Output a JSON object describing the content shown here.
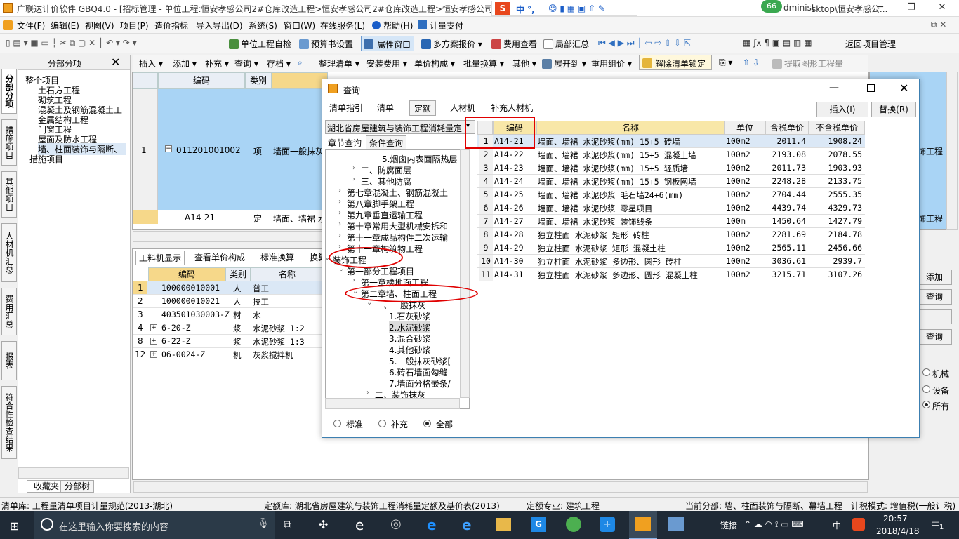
{
  "window": {
    "title": "广联达计价软件 GBQ4.0 - [招标管理 - 单位工程:恒安孝感公司2#仓库改造工程>恒安孝感公司2#仓库改造工程>恒安孝感公司2#",
    "title_tail": "dministrator.PC-20141127NRH",
    "title_tail2": "sktop\\恒安孝感公...",
    "badge": "66",
    "min": "─",
    "max": "❐",
    "close": "✕"
  },
  "menubar": [
    "文件(F)",
    "编辑(E)",
    "视图(V)",
    "项目(P)",
    "造价指标",
    "导入导出(D)",
    "系统(S)",
    "窗口(W)",
    "在线服务(L)",
    "帮助(H)",
    "计量支付"
  ],
  "toolbar1": {
    "self_check": "单位工程自检",
    "budget_settings": "预算书设置",
    "property_window": "属性窗口",
    "multi_plan": "多方案报价",
    "fee_view": "费用查看",
    "partial_total": "局部汇总",
    "return_project": "返回项目管理"
  },
  "toolbar2": [
    "插入",
    "添加",
    "补充",
    "查询",
    "存档",
    "整理清单",
    "安装费用",
    "单价构成",
    "批量换算",
    "其他",
    "展开到",
    "重用组价",
    "解除清单锁定",
    "提取图形工程量"
  ],
  "vtabs": [
    "分部分项",
    "措施项目",
    "其他项目",
    "人材机汇总",
    "费用汇总",
    "报表",
    "符合性检查结果"
  ],
  "leftpanel": {
    "title": "分部分项",
    "items": [
      "整个项目",
      "土石方工程",
      "砌筑工程",
      "混凝土及钢筋混凝土工",
      "金属结构工程",
      "门窗工程",
      "屋面及防水工程",
      "墙、柱面装饰与隔断、",
      "措施项目"
    ],
    "bottom_tabs": [
      "收藏夹",
      "分部树"
    ]
  },
  "grid": {
    "headers": [
      "编码",
      "类别"
    ],
    "rows": [
      {
        "num": "1",
        "code": "011201001002",
        "type": "项",
        "name": "墙面一般抹灰",
        "tail": "饰工程"
      },
      {
        "num": "",
        "code": "A14-21",
        "type": "定",
        "name": "墙面、墙裙 水",
        "tail": "饰工程"
      }
    ]
  },
  "lower": {
    "tabs": [
      "工料机显示",
      "查看单价构成",
      "标准换算",
      "换算"
    ],
    "headers": [
      "编码",
      "类别",
      "名称"
    ],
    "rows": [
      {
        "num": "1",
        "code": "100000010001",
        "type": "人",
        "name": "普工"
      },
      {
        "num": "2",
        "code": "100000010021",
        "type": "人",
        "name": "技工"
      },
      {
        "num": "3",
        "code": "403501030003-Z",
        "type": "材",
        "name": "水"
      },
      {
        "num": "4",
        "code": "6-20-Z",
        "type": "浆",
        "name": "水泥砂浆 1:2"
      },
      {
        "num": "8",
        "code": "6-22-Z",
        "type": "浆",
        "name": "水泥砂浆 1:3"
      },
      {
        "num": "12",
        "code": "06-0024-Z",
        "type": "机",
        "name": "灰浆搅拌机"
      }
    ]
  },
  "right_side": {
    "buttons": [
      "添加",
      "查询",
      "查询"
    ],
    "radios": [
      {
        "label": "机械",
        "on": false
      },
      {
        "label": "设备",
        "on": false
      },
      {
        "label": "所有",
        "on": true
      }
    ]
  },
  "dialog": {
    "title": "查询",
    "tabs": [
      "清单指引",
      "清单",
      "定额",
      "人材机",
      "补充人材机"
    ],
    "insert_btn": "插入(I)",
    "replace_btn": "替换(R)",
    "quota_library": "湖北省房屋建筑与装饰工程消耗量定",
    "subtabs": [
      "章节查询",
      "条件查询"
    ],
    "tree": [
      {
        "text": "5.烟囱内表面隔热层",
        "indent": 80
      },
      {
        "text": "二、防腐面层",
        "indent": 50
      },
      {
        "text": "三、其他防腐",
        "indent": 50
      },
      {
        "text": "第七章混凝土、钢筋混凝土",
        "indent": 30
      },
      {
        "text": "第八章脚手架工程",
        "indent": 30
      },
      {
        "text": "第九章垂直运输工程",
        "indent": 30
      },
      {
        "text": "第十章常用大型机械安拆和",
        "indent": 30
      },
      {
        "text": "第十一章成品构件二次运输",
        "indent": 30
      },
      {
        "text": "第十一章构筑物工程",
        "indent": 30
      },
      {
        "text": "装饰工程",
        "indent": 10
      },
      {
        "text": "第一部分工程项目",
        "indent": 30
      },
      {
        "text": "第一章楼地面工程",
        "indent": 50
      },
      {
        "text": "第二章墙、柱面工程",
        "indent": 50
      },
      {
        "text": "一、一般抹灰",
        "indent": 70
      },
      {
        "text": "1.石灰砂浆",
        "indent": 90
      },
      {
        "text": "2.水泥砂浆",
        "indent": 90
      },
      {
        "text": "3.混合砂浆",
        "indent": 90
      },
      {
        "text": "4.其他砂浆",
        "indent": 90
      },
      {
        "text": "5.一般抹灰砂浆[",
        "indent": 90
      },
      {
        "text": "6.砖石墙面勾缝",
        "indent": 90
      },
      {
        "text": "7.墙面分格嵌条/",
        "indent": 90
      },
      {
        "text": "二、装饰抹灰",
        "indent": 70
      }
    ],
    "radios": [
      {
        "label": "标准",
        "on": false
      },
      {
        "label": "补充",
        "on": false
      },
      {
        "label": "全部",
        "on": true
      }
    ],
    "table_headers": [
      "编码",
      "名称",
      "单位",
      "含税单价",
      "不含税单价"
    ],
    "table_rows": [
      {
        "n": "1",
        "code": "A14-21",
        "name": "墙面、墙裙 水泥砂浆(mm) 15+5 砖墙",
        "unit": "100m2",
        "tax": "2011.4",
        "notax": "1908.24"
      },
      {
        "n": "2",
        "code": "A14-22",
        "name": "墙面、墙裙 水泥砂浆(mm) 15+5 混凝土墙",
        "unit": "100m2",
        "tax": "2193.08",
        "notax": "2078.55"
      },
      {
        "n": "3",
        "code": "A14-23",
        "name": "墙面、墙裙 水泥砂浆(mm) 15+5 轻质墙",
        "unit": "100m2",
        "tax": "2011.73",
        "notax": "1903.93"
      },
      {
        "n": "4",
        "code": "A14-24",
        "name": "墙面、墙裙 水泥砂浆(mm) 15+5 钢板网墙",
        "unit": "100m2",
        "tax": "2248.28",
        "notax": "2133.75"
      },
      {
        "n": "5",
        "code": "A14-25",
        "name": "墙面、墙裙 水泥砂浆 毛石墙24+6(mm)",
        "unit": "100m2",
        "tax": "2704.44",
        "notax": "2555.35"
      },
      {
        "n": "6",
        "code": "A14-26",
        "name": "墙面、墙裙 水泥砂浆 零星项目",
        "unit": "100m2",
        "tax": "4439.74",
        "notax": "4329.73"
      },
      {
        "n": "7",
        "code": "A14-27",
        "name": "墙面、墙裙 水泥砂浆 装饰线条",
        "unit": "100m",
        "tax": "1450.64",
        "notax": "1427.79"
      },
      {
        "n": "8",
        "code": "A14-28",
        "name": "独立柱面 水泥砂浆 矩形 砖柱",
        "unit": "100m2",
        "tax": "2281.69",
        "notax": "2184.78"
      },
      {
        "n": "9",
        "code": "A14-29",
        "name": "独立柱面 水泥砂浆 矩形 混凝土柱",
        "unit": "100m2",
        "tax": "2565.11",
        "notax": "2456.66"
      },
      {
        "n": "10",
        "code": "A14-30",
        "name": "独立柱面 水泥砂浆 多边形、圆形 砖柱",
        "unit": "100m2",
        "tax": "3036.61",
        "notax": "2939.7"
      },
      {
        "n": "11",
        "code": "A14-31",
        "name": "独立柱面 水泥砂浆 多边形、圆形 混凝土柱",
        "unit": "100m2",
        "tax": "3215.71",
        "notax": "3107.26"
      }
    ]
  },
  "statusbar": [
    "清单库: 工程量清单项目计量规范(2013-湖北)",
    "定额库: 湖北省房屋建筑与装饰工程消耗量定额及基价表(2013)",
    "定额专业: 建筑工程",
    "当前分部: 墙、柱面装饰与隔断、幕墙工程",
    "计税模式: 增值税(一般计税)"
  ],
  "taskbar": {
    "search_placeholder": "在这里输入你要搜索的内容",
    "link_label": "链接",
    "lang": "中",
    "time": "20:57",
    "date": "2018/4/18",
    "notif": "1"
  },
  "ime": {
    "label": "中 °,"
  }
}
